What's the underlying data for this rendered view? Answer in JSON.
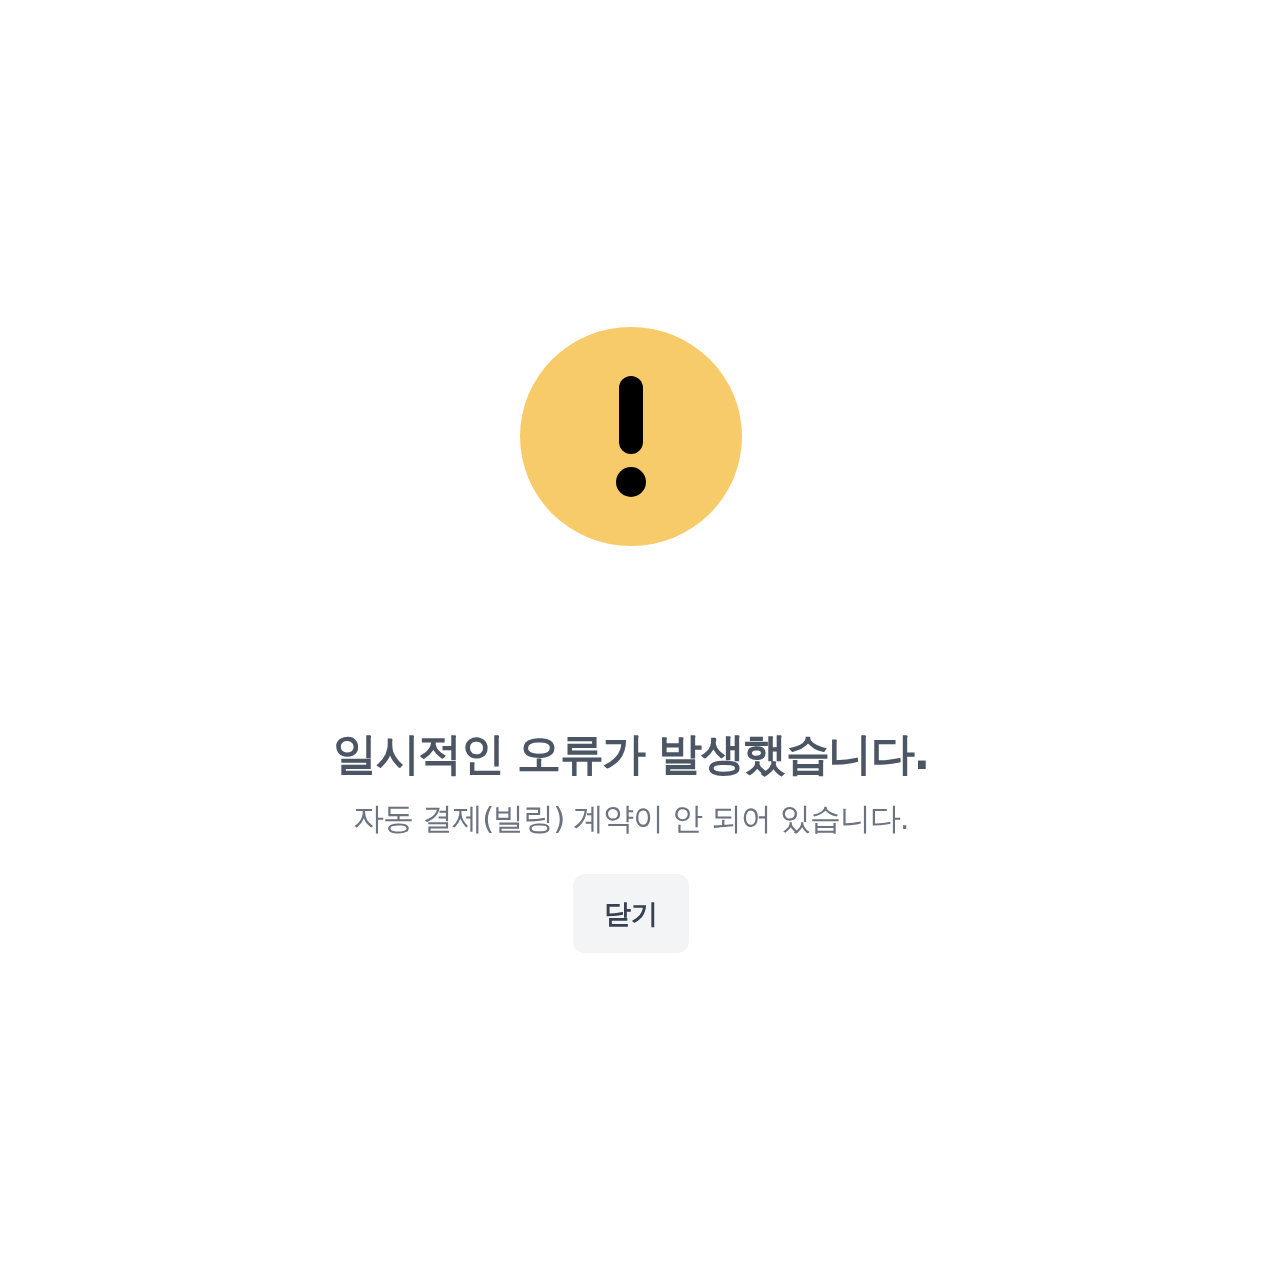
{
  "dialog": {
    "title": "일시적인 오류가 발생했습니다.",
    "message": "자동 결제(빌링) 계약이 안 되어 있습니다.",
    "button": "닫기"
  }
}
